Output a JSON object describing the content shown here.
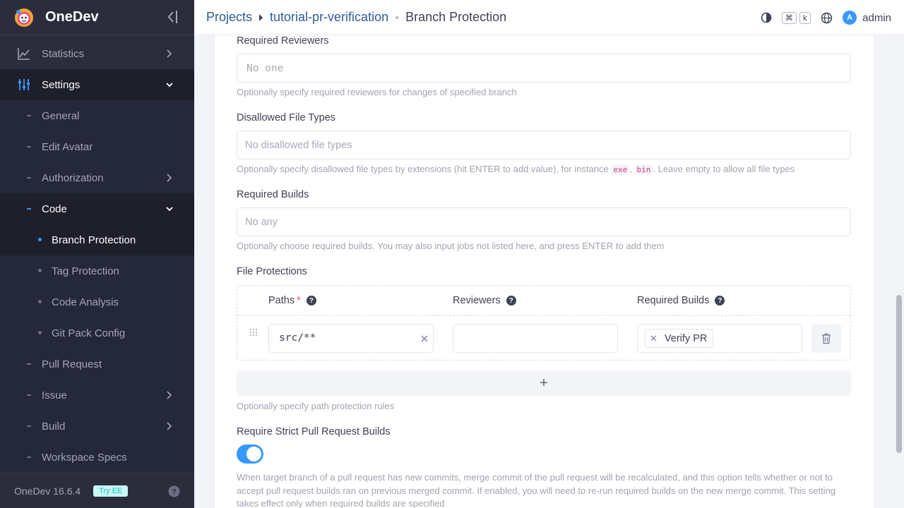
{
  "app": {
    "name": "OneDev",
    "version": "OneDev 16.6.4",
    "try_ee": "Try EE"
  },
  "breadcrumb": {
    "projects": "Projects",
    "project": "tutorial-pr-verification",
    "current": "Branch Protection"
  },
  "header": {
    "kbd_cmd": "⌘",
    "kbd_k": "k",
    "avatar_letter": "A",
    "username": "admin"
  },
  "sidebar": {
    "statistics": "Statistics",
    "settings": "Settings",
    "general": "General",
    "edit_avatar": "Edit Avatar",
    "authorization": "Authorization",
    "code": "Code",
    "branch_protection": "Branch Protection",
    "tag_protection": "Tag Protection",
    "code_analysis": "Code Analysis",
    "git_pack_config": "Git Pack Config",
    "pull_request": "Pull Request",
    "issue": "Issue",
    "build": "Build",
    "workspace_specs": "Workspace Specs"
  },
  "form": {
    "required_reviewers": {
      "label": "Required Reviewers",
      "placeholder": "No one",
      "help": "Optionally specify required reviewers for changes of specified branch"
    },
    "disallowed_file_types": {
      "label": "Disallowed File Types",
      "placeholder": "No disallowed file types",
      "help_pre": "Optionally specify disallowed file types by extensions (hit ENTER to add value), for instance",
      "ext1": "exe",
      "ext2": "bin",
      "help_post": ". Leave empty to allow all file types"
    },
    "required_builds": {
      "label": "Required Builds",
      "placeholder": "No any",
      "help": "Optionally choose required builds. You may also input jobs not listed here, and press ENTER to add them"
    },
    "file_protections": {
      "label": "File Protections",
      "col_paths": "Paths",
      "required_mark": "*",
      "col_reviewers": "Reviewers",
      "col_required_builds": "Required Builds",
      "row": {
        "path": "src/**",
        "reviewers": "",
        "build_tag": "Verify PR"
      },
      "add": "+",
      "help": "Optionally specify path protection rules"
    },
    "strict_pr_builds": {
      "label": "Require Strict Pull Request Builds",
      "enabled": true,
      "help": "When target branch of a pull request has new commits, merge commit of the pull request will be recalculated, and this option tells whether or not to accept pull request builds ran on previous merged commit. If enabled, you will need to re-run required builds on the new merge commit. This setting takes effect only when required builds are specified"
    }
  },
  "colors": {
    "accent": "#3699ff",
    "sidebar_bg": "#2b2d3c",
    "link": "#2e5b94"
  }
}
